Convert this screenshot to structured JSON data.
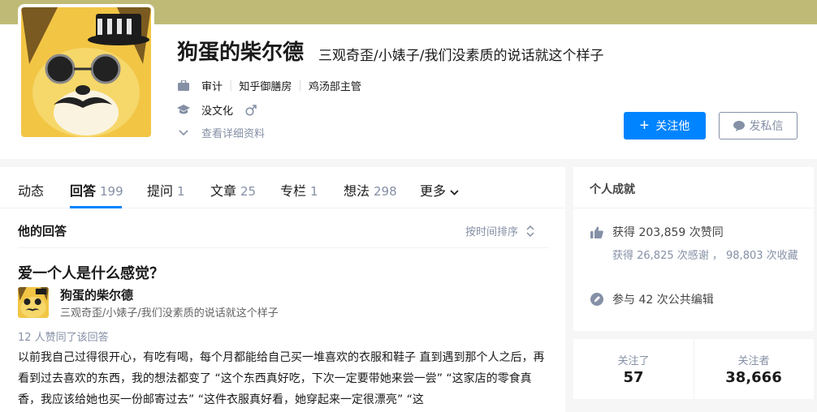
{
  "profile": {
    "name": "狗蛋的柴尔德",
    "headline": "三观奇歪/小婊子/我们没素质的说话就这个样子",
    "employment": [
      "审计",
      "知乎御膳房",
      "鸡汤部主管"
    ],
    "education": "没文化",
    "gender_icon": "male-icon",
    "details_link": "查看详细资料",
    "follow_label": "关注他",
    "message_label": "发私信"
  },
  "tabs": [
    {
      "label": "动态",
      "count": ""
    },
    {
      "label": "回答",
      "count": "199"
    },
    {
      "label": "提问",
      "count": "1"
    },
    {
      "label": "文章",
      "count": "25"
    },
    {
      "label": "专栏",
      "count": "1"
    },
    {
      "label": "想法",
      "count": "298"
    },
    {
      "label": "更多",
      "count": ""
    }
  ],
  "answers": {
    "section_title": "他的回答",
    "sort_label": "按时间排序",
    "item": {
      "question": "爱一个人是什么感觉？",
      "author_name": "狗蛋的柴尔德",
      "author_headline": "三观奇歪/小婊子/我们没素质的说话就这个样子",
      "votes": "12 人赞同了该回答",
      "excerpt": "以前我自己过得很开心，有吃有喝，每个月都能给自己买一堆喜欢的衣服和鞋子 直到遇到那个人之后，再看到过去喜欢的东西，我的想法都变了 “这个东西真好吃，下次一定要带她来尝一尝” “这家店的零食真香，我应该给她也买一份邮寄过去” “这件衣服真好看，她穿起来一定很漂亮” “这"
    }
  },
  "achievements": {
    "title": "个人成就",
    "likes": "获得 203,859 次赞同",
    "thanks_favs": "获得 26,825 次感谢 ， 98,803 次收藏",
    "edits": "参与 42 次公共编辑"
  },
  "follow_stats": {
    "following_label": "关注了",
    "following_count": "57",
    "followers_label": "关注者",
    "followers_count": "38,666"
  },
  "colors": {
    "cover": "#bfbb76",
    "accent": "#0084ff",
    "muted": "#8590a6"
  }
}
